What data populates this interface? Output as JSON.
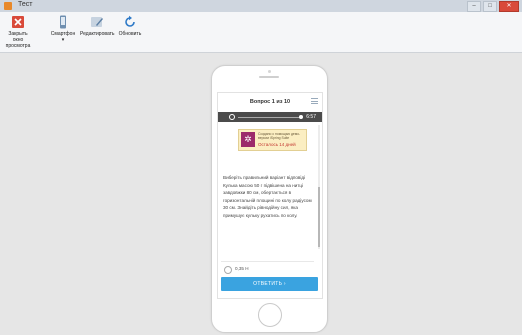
{
  "window": {
    "title": "Тест"
  },
  "ribbon": {
    "close_preview": "Закрыть окно просмотра",
    "device": "Смартфон",
    "edit": "Редактировать",
    "refresh": "Обновить"
  },
  "quiz": {
    "header": "Вопрос 1 из 10",
    "timer": "6:57",
    "banner": {
      "line1": "Создано с помощью демо-версии iSpring Suite",
      "line2": "Осталось 14 дней"
    },
    "instruction": "Виберіть правильний варіант відповіді",
    "question": "Кулька масою 50 г підвішена на нитці завдовжки 80 см, обертається в горизонтальній площині по колу радіусом 30 см. Знайдіть рівнодійну сил, яка примушує кульку рухатись по колу.",
    "answer_option": "0,35 Н",
    "submit_label": "ОТВЕТИТЬ ›"
  },
  "colors": {
    "accent": "#3aa3e0",
    "close_red": "#d94a3a"
  }
}
